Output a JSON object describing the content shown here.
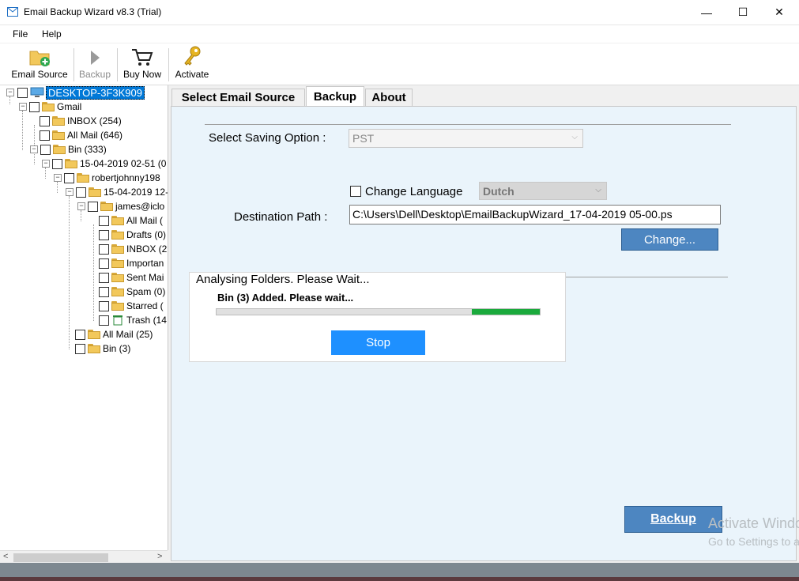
{
  "window": {
    "title": "Email Backup Wizard v8.3 (Trial)",
    "minimize": "—",
    "maximize": "☐",
    "close": "✕"
  },
  "menu": {
    "file": "File",
    "help": "Help"
  },
  "toolbar": {
    "email_source": "Email Source",
    "backup": "Backup",
    "buy_now": "Buy Now",
    "activate": "Activate"
  },
  "tree": {
    "root": "DESKTOP-3F3K909",
    "gmail": "Gmail",
    "inbox": "INBOX (254)",
    "allmail": "All Mail (646)",
    "bin": "Bin (333)",
    "date1": "15-04-2019 02-51 (0",
    "robert": "robertjohnny198",
    "date2": "15-04-2019 12-",
    "james": "james@iclo",
    "sub_allmail": "All Mail (",
    "sub_drafts": "Drafts (0)",
    "sub_inbox": "INBOX (2",
    "sub_important": "Importan",
    "sub_sent": "Sent Mai",
    "sub_spam": "Spam (0)",
    "sub_starred": "Starred (",
    "sub_trash": "Trash (14",
    "allmail25": "All Mail (25)",
    "bin3": "Bin (3)"
  },
  "tabs": {
    "select_source": "Select Email Source",
    "backup": "Backup",
    "about": "About"
  },
  "backup": {
    "saving_option_label": "Select Saving Option :",
    "saving_option_value": "PST",
    "change_language_label": "Change Language",
    "language_value": "Dutch",
    "destination_label": "Destination Path :",
    "destination_value": "C:\\Users\\Dell\\Desktop\\EmailBackupWizard_17-04-2019 05-00.ps",
    "change_button": "Change...",
    "backup_button": "Backup"
  },
  "progress": {
    "heading": "Analysing Folders. Please Wait...",
    "status": "Bin (3) Added. Please wait...",
    "fraction": 0.21,
    "stop_button": "Stop"
  },
  "watermark": {
    "line1": "Activate Windows",
    "line2": "Go to Settings to activate Windows."
  },
  "colors": {
    "accent": "#4d86c1",
    "progress": "#1aaa3c",
    "stop": "#1e90ff",
    "selection": "#0078d7"
  }
}
